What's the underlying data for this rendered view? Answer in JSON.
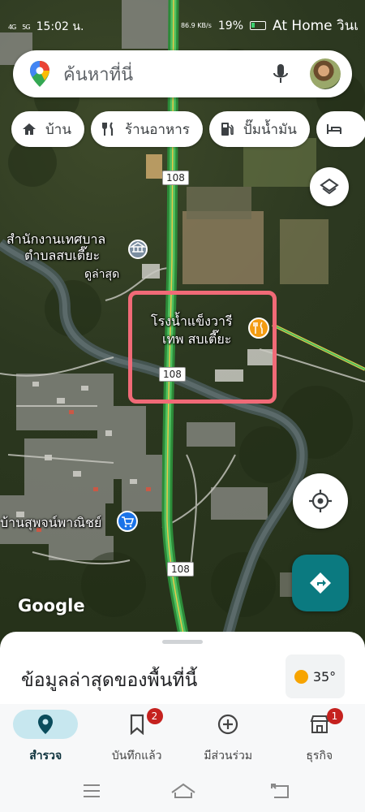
{
  "status_bar": {
    "network_left": "4G",
    "network_right": "5G",
    "time": "15:02 น.",
    "speed": "86.9 KB/s",
    "battery": "19%",
    "notification": "At Home วินเ"
  },
  "search": {
    "placeholder": "ค้นหาที่นี่"
  },
  "chips": [
    {
      "label": "บ้าน",
      "icon": "home-icon"
    },
    {
      "label": "ร้านอาหาร",
      "icon": "restaurant-icon"
    },
    {
      "label": "ปั๊มน้ำมัน",
      "icon": "gas-station-icon"
    }
  ],
  "map": {
    "labels": {
      "office_line1": "สำนักงานเทศบาล",
      "office_line2": "ตำบลสบเตี๊ยะ",
      "office_sub": "ดูล่าสุด",
      "factory_line1": "โรงน้ำแข็งวารี",
      "factory_line2": "เทพ สบเตี๊ยะ",
      "shop": "บ้านสุพจน์พาณิชย์"
    },
    "road_shield": "108",
    "logo": "Google"
  },
  "bottom_sheet": {
    "title": "ข้อมูลล่าสุดของพื้นที่นี้"
  },
  "weather": {
    "temperature": "35°"
  },
  "nav": [
    {
      "label": "สำรวจ",
      "active": true,
      "badge": ""
    },
    {
      "label": "บันทึกแล้ว",
      "active": false,
      "badge": "2"
    },
    {
      "label": "มีส่วนร่วม",
      "active": false,
      "badge": ""
    },
    {
      "label": "ธุรกิจ",
      "active": false,
      "badge": "1"
    }
  ],
  "colors": {
    "highlight": "#f06a77",
    "accent": "#0b7a80",
    "road": "#3fb24a",
    "badge": "#c5221f"
  }
}
